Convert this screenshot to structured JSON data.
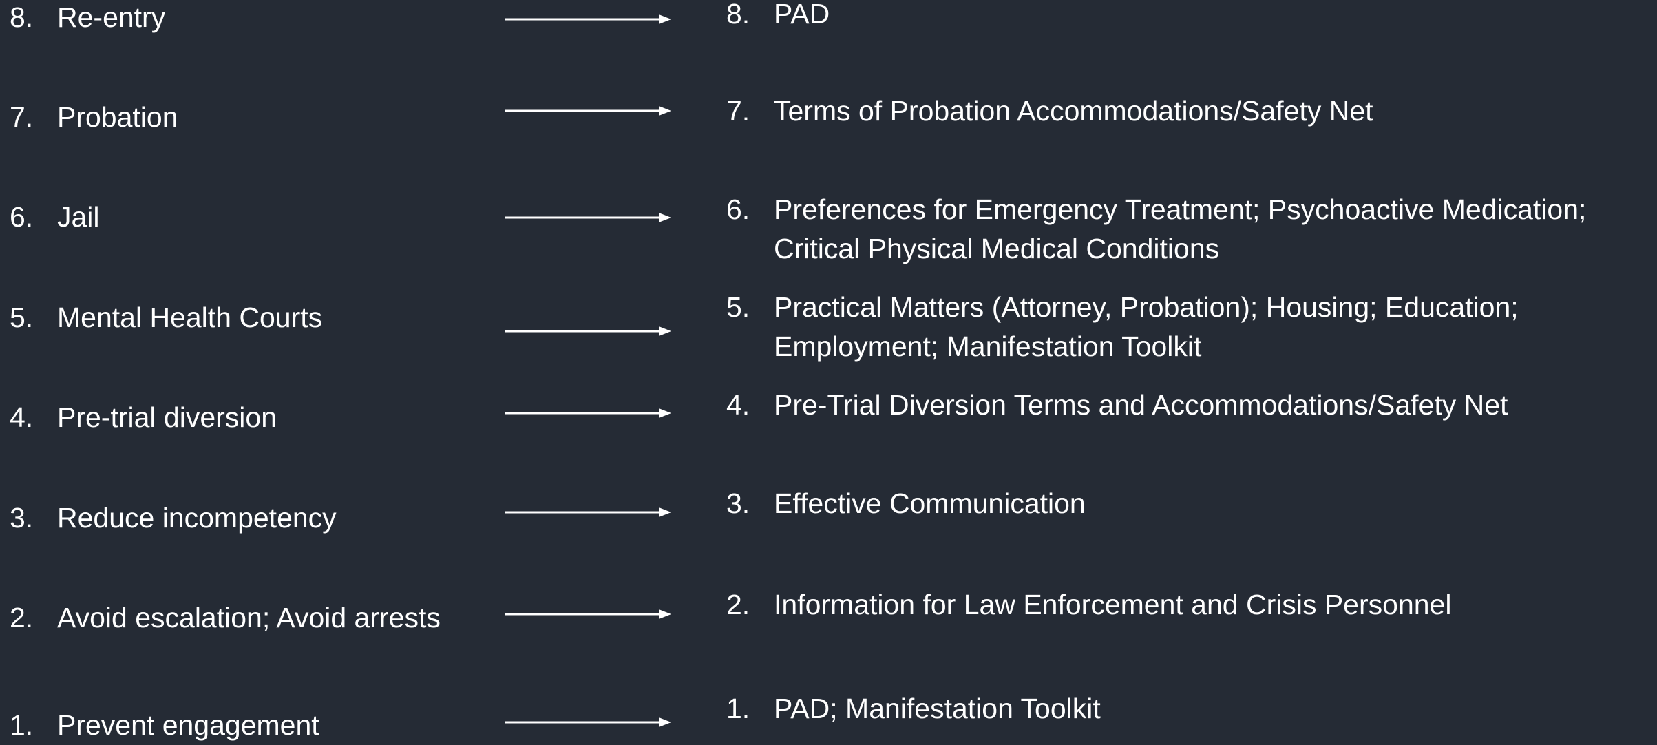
{
  "colors": {
    "background": "#252b35",
    "text": "#ffffff",
    "arrow": "#ffffff"
  },
  "left_items": [
    {
      "number": "8.",
      "label": "Re-entry"
    },
    {
      "number": "7.",
      "label": "Probation"
    },
    {
      "number": "6.",
      "label": "Jail"
    },
    {
      "number": "5.",
      "label": "Mental Health Courts"
    },
    {
      "number": "4.",
      "label": "Pre-trial diversion"
    },
    {
      "number": "3.",
      "label": "Reduce incompetency"
    },
    {
      "number": "2.",
      "label": "Avoid escalation; Avoid arrests"
    },
    {
      "number": "1.",
      "label": "Prevent engagement"
    }
  ],
  "right_items": [
    {
      "number": "8.",
      "lines": [
        "PAD"
      ]
    },
    {
      "number": "7.",
      "lines": [
        "Terms of Probation Accommodations/Safety Net"
      ]
    },
    {
      "number": "6.",
      "lines": [
        "Preferences for Emergency Treatment; Psychoactive Medication;",
        "Critical Physical Medical Conditions"
      ]
    },
    {
      "number": "5.",
      "lines": [
        "Practical Matters (Attorney, Probation); Housing; Education;",
        "Employment; Manifestation Toolkit"
      ]
    },
    {
      "number": "4.",
      "lines": [
        "Pre-Trial Diversion Terms and Accommodations/Safety Net"
      ]
    },
    {
      "number": "3.",
      "lines": [
        "Effective Communication"
      ]
    },
    {
      "number": "2.",
      "lines": [
        "Information for Law Enforcement and Crisis Personnel"
      ]
    },
    {
      "number": "1.",
      "lines": [
        "PAD; Manifestation Toolkit"
      ]
    }
  ]
}
